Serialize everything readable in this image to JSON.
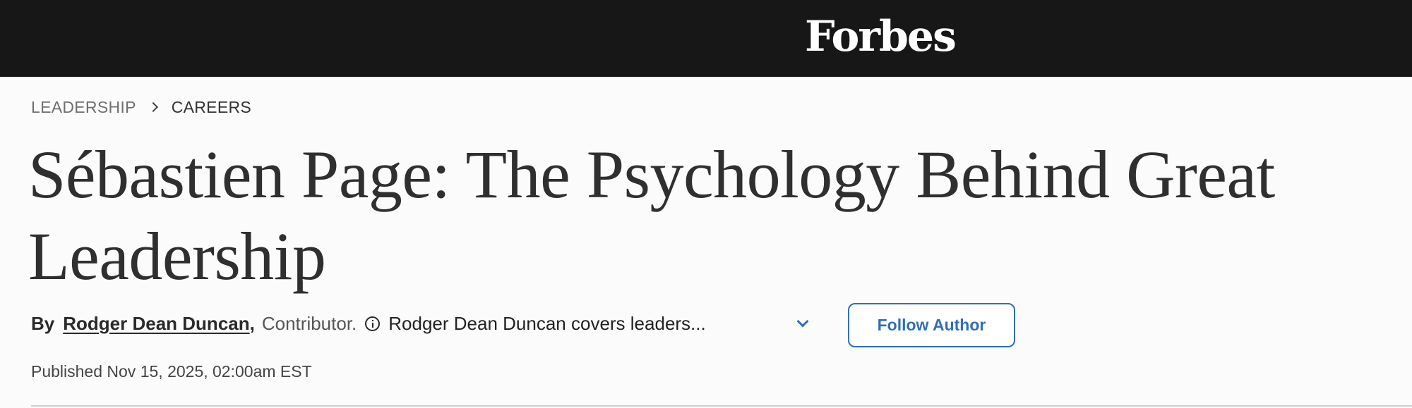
{
  "header": {
    "logo_text": "Forbes",
    "background_color": "#171717"
  },
  "breadcrumb": {
    "items": [
      "LEADERSHIP",
      "CAREERS"
    ],
    "separator_icon": "chevron-right-icon"
  },
  "article": {
    "headline": "Sébastien Page: The Psychology Behind Great Leadership",
    "byline": {
      "prefix": "By",
      "author": "Rodger Dean Duncan",
      "comma": ",",
      "role": "Contributor.",
      "info_icon": "info-icon",
      "bio_snippet": "Rodger Dean Duncan covers leaders...",
      "expand_icon": "chevron-down-icon"
    },
    "follow_label": "Follow Author",
    "published": "Published Nov 15, 2025, 02:00am EST"
  },
  "colors": {
    "accent": "#2f6fb5",
    "headline": "#2f2f2f",
    "page_background": "#fbfbfb"
  }
}
